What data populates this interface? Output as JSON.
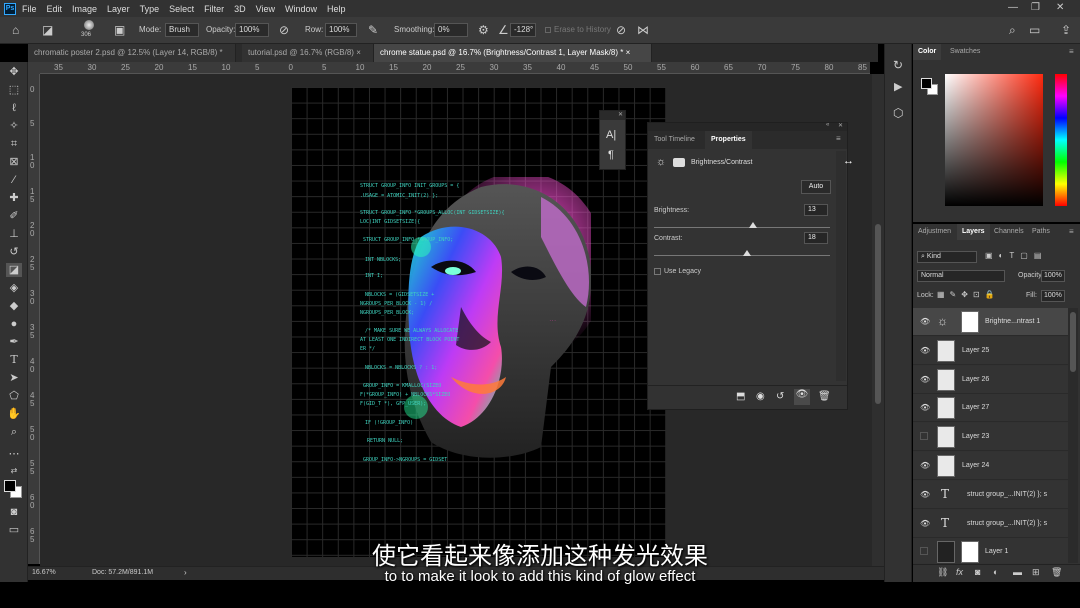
{
  "menu": {
    "logo": "Ps",
    "items": [
      "File",
      "Edit",
      "Image",
      "Layer",
      "Type",
      "Select",
      "Filter",
      "3D",
      "View",
      "Window",
      "Help"
    ]
  },
  "options_bar": {
    "brush_size": "306",
    "mode_label": "Mode:",
    "mode_value": "Brush",
    "opacity_label": "Opacity:",
    "opacity_value": "100%",
    "flow_label": "Row:",
    "flow_value": "100%",
    "smoothing_label": "Smoothing:",
    "smoothing_value": "0%",
    "angle_value": "-128°",
    "erase_history": "Erase to History"
  },
  "tabs": [
    {
      "label": "chromatic poster 2.psd @ 12.5% (Layer 14, RGB/8) *",
      "close": "×"
    },
    {
      "label": "tutorial.psd @ 16.7% (RGB/8)",
      "close": "×"
    },
    {
      "label": "chrome statue.psd @ 16.7% (Brightness/Contrast 1, Layer Mask/8) *",
      "close": "×"
    }
  ],
  "ruler_h": [
    "35",
    "30",
    "25",
    "20",
    "15",
    "10",
    "5",
    "0",
    "5",
    "10",
    "15",
    "20",
    "25",
    "30",
    "35",
    "40",
    "45",
    "50",
    "55",
    "60",
    "65",
    "70",
    "75",
    "80",
    "85"
  ],
  "ruler_v": [
    "0",
    "5",
    "1\n0",
    "1\n5",
    "2\n0",
    "2\n5",
    "3\n0",
    "3\n5",
    "4\n0",
    "4\n5",
    "5\n0",
    "5\n5",
    "6\n0",
    "6\n5"
  ],
  "canvas_code": [
    "STRUCT GROUP_INFO INIT_GROUPS = {",
    ".USAGE = ATOMIC_INIT(2) };",
    "STRUCT GROUP_INFO *GROUPS_ALLOC(INT GIDSETSIZE){",
    "LOC(INT GIDSETSIZE){",
    "STRUCT GROUP_INFO *GROUP_INFO;",
    "INT NBLOCKS;",
    "INT I;",
    "NBLOCKS = (GIDSETSIZE +",
    "NGROUPS_PER_BLOCK - 1) /",
    "NGROUPS_PER_BLOCK;",
    "/* MAKE SURE WE ALWAYS ALLOCATE",
    "AT LEAST ONE INDIRECT BLOCK POINT",
    "ER */",
    "NBLOCKS = NBLOCKS ? : 1;",
    "GROUP_INFO = KMALLOC(SIZEO",
    "F(*GROUP_INFO) + NBLOCKS*SIZEO",
    "F(GID_T *), GFP_USER);",
    "IF (!GROUP_INFO)",
    "RETURN NULL;",
    "GROUP_INFO->NGROUPS = GIDSET"
  ],
  "statusbar": {
    "zoom": "16.67%",
    "doc": "Doc: 57.2M/891.1M",
    "arrow": "›"
  },
  "mini_panel": {
    "char_icon": "A|",
    "para_icon": "¶"
  },
  "properties": {
    "tab_timeline": "Tool Timeline",
    "tab_properties": "Properties",
    "adjustment_name": "Brightness/Contrast",
    "auto_label": "Auto",
    "brightness_label": "Brightness:",
    "brightness_value": "13",
    "brightness_fraction": 0.56,
    "contrast_label": "Contrast:",
    "contrast_value": "18",
    "contrast_fraction": 0.53,
    "legacy_label": "Use Legacy"
  },
  "color_panel": {
    "tab_color": "Color",
    "tab_swatches": "Swatches",
    "hue_color": "#ff2a10"
  },
  "layers_panel": {
    "tabs": [
      "Adjustmen",
      "Layers",
      "Channels",
      "Paths"
    ],
    "kind_label": "Kind",
    "blend_mode": "Normal",
    "opacity_label": "Opacity:",
    "opacity_value": "100%",
    "lock_label": "Lock:",
    "fill_label": "Fill:",
    "fill_value": "100%",
    "layers": [
      {
        "name": "Brightne...ntrast 1",
        "type": "adjustment",
        "visible": true,
        "selected": true
      },
      {
        "name": "Layer 25",
        "type": "pixel",
        "visible": true
      },
      {
        "name": "Layer 26",
        "type": "pixel",
        "visible": true
      },
      {
        "name": "Layer 27",
        "type": "pixel",
        "visible": true
      },
      {
        "name": "Layer 23",
        "type": "pixel",
        "visible": false
      },
      {
        "name": "Layer 24",
        "type": "pixel",
        "visible": true
      },
      {
        "name": "struct group_...INIT(2) }; s",
        "type": "text",
        "visible": true
      },
      {
        "name": "struct group_...INIT(2) }; s",
        "type": "text",
        "visible": true
      },
      {
        "name": "Layer 1",
        "type": "pixel-masked",
        "visible": false
      }
    ]
  },
  "subtitles": {
    "zh": "使它看起来像添加这种发光效果",
    "en": "to to make it look to add this kind of glow effect"
  }
}
